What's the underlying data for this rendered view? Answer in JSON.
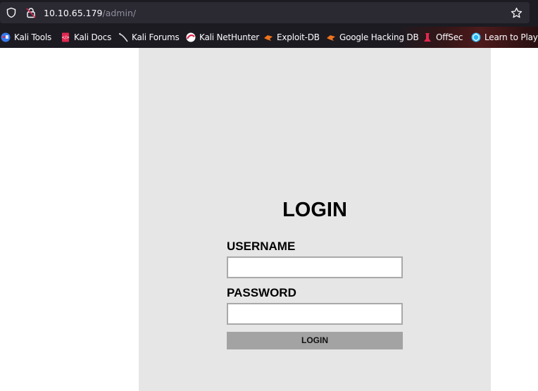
{
  "browser": {
    "url_host": "10.10.65.179",
    "url_path": "/admin/",
    "bookmarks": [
      {
        "label": "Kali Tools",
        "icon": "kali-tools-icon"
      },
      {
        "label": "Kali Docs",
        "icon": "kali-docs-icon"
      },
      {
        "label": "Kali Forums",
        "icon": "kali-forums-icon"
      },
      {
        "label": "Kali NetHunter",
        "icon": "kali-nethunter-icon"
      },
      {
        "label": "Exploit-DB",
        "icon": "exploit-db-icon"
      },
      {
        "label": "Google Hacking DB",
        "icon": "google-hacking-db-icon"
      },
      {
        "label": "OffSec",
        "icon": "offsec-icon"
      },
      {
        "label": "Learn to Play",
        "icon": "learn-to-play-icon"
      }
    ]
  },
  "login": {
    "title": "LOGIN",
    "username_label": "USERNAME",
    "username_value": "",
    "password_label": "PASSWORD",
    "password_value": "",
    "button_label": "LOGIN"
  },
  "colors": {
    "chrome_bg": "#1c1b22",
    "urlbar_bg": "#2b2a33",
    "panel_bg": "#e6e6e6",
    "button_bg": "#a3a3a3"
  }
}
